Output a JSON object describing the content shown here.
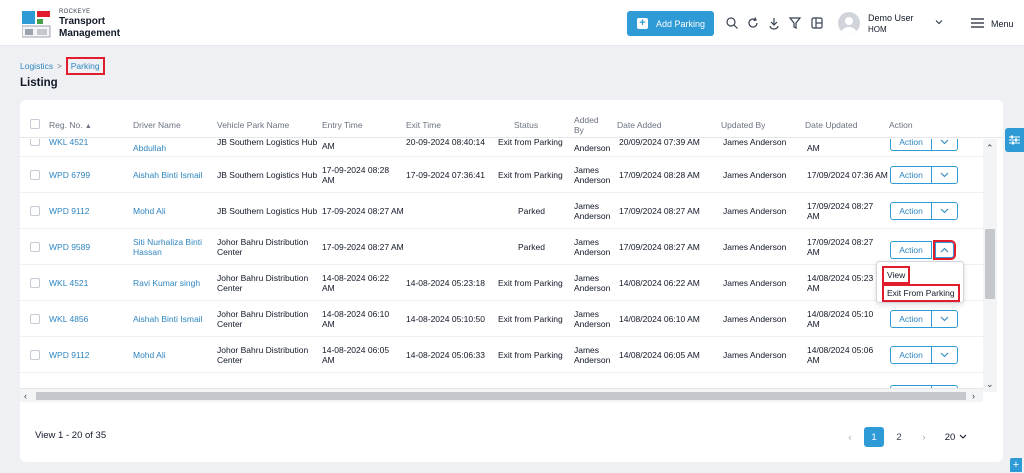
{
  "header": {
    "brand_small": "ROCKEYE",
    "brand_line1": "Transport",
    "brand_line2": "Management",
    "add_button": "Add Parking",
    "user_name": "Demo User",
    "user_role": "HOM",
    "menu_label": "Menu"
  },
  "breadcrumb": {
    "parent": "Logistics",
    "current": "Parking"
  },
  "page_title": "Listing",
  "table": {
    "headers": {
      "reg_no": "Reg. No.",
      "driver": "Driver Name",
      "park": "Vehicle Park Name",
      "entry": "Entry Time",
      "exit": "Exit Time",
      "status": "Status",
      "added_by_1": "Added",
      "added_by_2": "By",
      "date_added": "Date Added",
      "updated_by": "Updated By",
      "date_updated": "Date Updated",
      "action": "Action"
    },
    "rows": [
      {
        "reg": "WKL 4521",
        "driver": "Abdullah",
        "driver2": "",
        "park": "JB Southern Logistics Hub",
        "park2": "",
        "entry": "AM",
        "entry2": "",
        "exit": "20-09-2024 08:40:14",
        "status": "Exit from Parking",
        "added": "Anderson",
        "added2": "",
        "date_added": "20/09/2024 07:39 AM",
        "updated_by": "James Anderson",
        "date_updated": "AM",
        "date_updated2": "",
        "action": "Action"
      },
      {
        "reg": "WPD 6799",
        "driver": "Aishah Binti Ismail",
        "driver2": "",
        "park": "JB Southern Logistics Hub",
        "park2": "",
        "entry": "17-09-2024 08:28",
        "entry2": "AM",
        "exit": "17-09-2024 07:36:41",
        "status": "Exit from Parking",
        "added": "James",
        "added2": "Anderson",
        "date_added": "17/09/2024 08:28 AM",
        "updated_by": "James Anderson",
        "date_updated": "17/09/2024 07:36 AM",
        "date_updated2": "",
        "action": "Action"
      },
      {
        "reg": "WPD 9112",
        "driver": "Mohd Ali",
        "driver2": "",
        "park": "JB Southern Logistics Hub",
        "park2": "",
        "entry": "17-09-2024 08:27 AM",
        "entry2": "",
        "exit": "",
        "status": "Parked",
        "added": "James",
        "added2": "Anderson",
        "date_added": "17/09/2024 08:27 AM",
        "updated_by": "James Anderson",
        "date_updated": "17/09/2024 08:27",
        "date_updated2": "AM",
        "action": "Action"
      },
      {
        "reg": "WPD 9589",
        "driver": "Siti Nurhaliza Binti",
        "driver2": "Hassan",
        "park": "Johor Bahru Distribution",
        "park2": "Center",
        "entry": "17-09-2024 08:27 AM",
        "entry2": "",
        "exit": "",
        "status": "Parked",
        "added": "James",
        "added2": "Anderson",
        "date_added": "17/09/2024 08:27 AM",
        "updated_by": "James Anderson",
        "date_updated": "17/09/2024 08:27",
        "date_updated2": "AM",
        "action": "Action"
      },
      {
        "reg": "WKL 4521",
        "driver": "Ravi Kumar singh",
        "driver2": "",
        "park": "Johor Bahru Distribution",
        "park2": "Center",
        "entry": "14-08-2024 06:22",
        "entry2": "AM",
        "exit": "14-08-2024 05:23:18",
        "status": "Exit from Parking",
        "added": "James",
        "added2": "Anderson",
        "date_added": "14/08/2024 06:22 AM",
        "updated_by": "James Anderson",
        "date_updated": "14/08/2024 05:23",
        "date_updated2": "AM",
        "action": "Action"
      },
      {
        "reg": "WKL 4856",
        "driver": "Aishah Binti Ismail",
        "driver2": "",
        "park": "Johor Bahru Distribution",
        "park2": "Center",
        "entry": "14-08-2024 06:10",
        "entry2": "AM",
        "exit": "14-08-2024 05:10:50",
        "status": "Exit from Parking",
        "added": "James",
        "added2": "Anderson",
        "date_added": "14/08/2024 06:10 AM",
        "updated_by": "James Anderson",
        "date_updated": "14/08/2024 05:10",
        "date_updated2": "AM",
        "action": "Action"
      },
      {
        "reg": "WPD 9112",
        "driver": "Mohd Ali",
        "driver2": "",
        "park": "Johor Bahru Distribution",
        "park2": "Center",
        "entry": "14-08-2024 06:05",
        "entry2": "AM",
        "exit": "14-08-2024 05:06:33",
        "status": "Exit from Parking",
        "added": "James",
        "added2": "Anderson",
        "date_added": "14/08/2024 06:05 AM",
        "updated_by": "James Anderson",
        "date_updated": "14/08/2024 05:06",
        "date_updated2": "AM",
        "action": "Action"
      }
    ]
  },
  "dropdown": {
    "view": "View",
    "exit": "Exit From Parking"
  },
  "footer": {
    "summary": "View 1 - 20 of 35",
    "page1": "1",
    "page2": "2",
    "per_page": "20"
  },
  "colors": {
    "accent": "#2e9bd6",
    "link": "#2e86c1",
    "highlight": "#e11d2d"
  },
  "icons": [
    "search-icon",
    "refresh-icon",
    "download-icon",
    "filter-icon",
    "columns-icon",
    "chevron-down-icon",
    "menu-icon",
    "settings-sliders-icon",
    "plus-icon"
  ]
}
